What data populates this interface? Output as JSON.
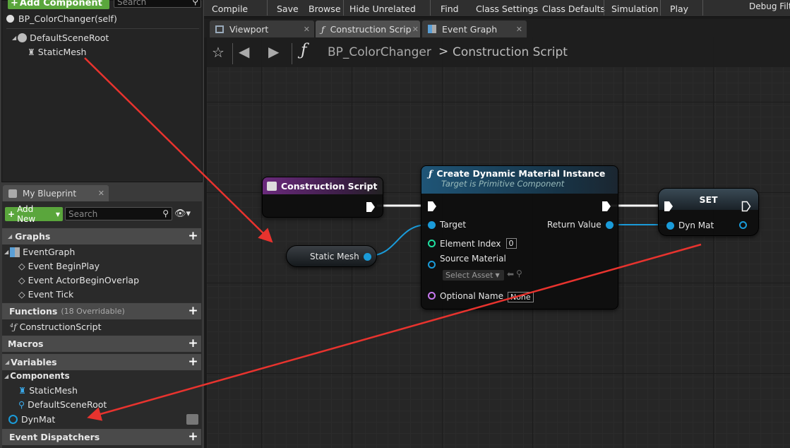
{
  "components": {
    "add_component_label": "Add Component",
    "search_placeholder": "Search",
    "self_label": "BP_ColorChanger(self)",
    "tree": [
      "DefaultSceneRoot",
      "StaticMesh"
    ]
  },
  "my_blueprint": {
    "tab_label": "My Blueprint",
    "add_new_label": "Add New",
    "search_placeholder": "Search",
    "sections": {
      "graphs": "Graphs",
      "functions": "Functions",
      "functions_note": "(18 Overridable)",
      "macros": "Macros",
      "variables": "Variables",
      "components": "Components",
      "event_dispatchers": "Event Dispatchers"
    },
    "event_graph": "EventGraph",
    "events": [
      "Event BeginPlay",
      "Event ActorBeginOverlap",
      "Event Tick"
    ],
    "functions": [
      "ConstructionScript"
    ],
    "component_vars": [
      "StaticMesh",
      "DefaultSceneRoot"
    ],
    "variables": [
      "DynMat"
    ]
  },
  "toolbar": {
    "items": [
      "Compile",
      "Save",
      "Browse",
      "Hide Unrelated",
      "Find",
      "Class Settings",
      "Class Defaults",
      "Simulation",
      "Play"
    ],
    "debug_filter": "Debug Filte"
  },
  "tabs": [
    "Viewport",
    "Construction Scrip",
    "Event Graph"
  ],
  "breadcrumb": {
    "blueprint": "BP_ColorChanger",
    "separator": ">",
    "graph": "Construction Script"
  },
  "nodes": {
    "construction_script": {
      "title": "Construction Script"
    },
    "create_dmi": {
      "title": "Create Dynamic Material Instance",
      "subtitle": "Target is Primitive Component",
      "target": "Target",
      "return_value": "Return Value",
      "element_index": "Element Index",
      "element_index_value": "0",
      "source_material": "Source Material",
      "select_asset": "Select Asset",
      "optional_name": "Optional Name",
      "optional_name_value": "None"
    },
    "set": {
      "title": "SET",
      "pin": "Dyn Mat"
    },
    "static_mesh": {
      "label": "Static Mesh"
    }
  },
  "colors": {
    "object_pin": "#1a9bd9",
    "int_pin": "#1fe0a0",
    "name_pin": "#c879f0",
    "function_header": "#1f4d6b",
    "event_header": "#6a2a7c",
    "annotation_arrow": "#e8332e",
    "add_green": "#5aa63c"
  }
}
